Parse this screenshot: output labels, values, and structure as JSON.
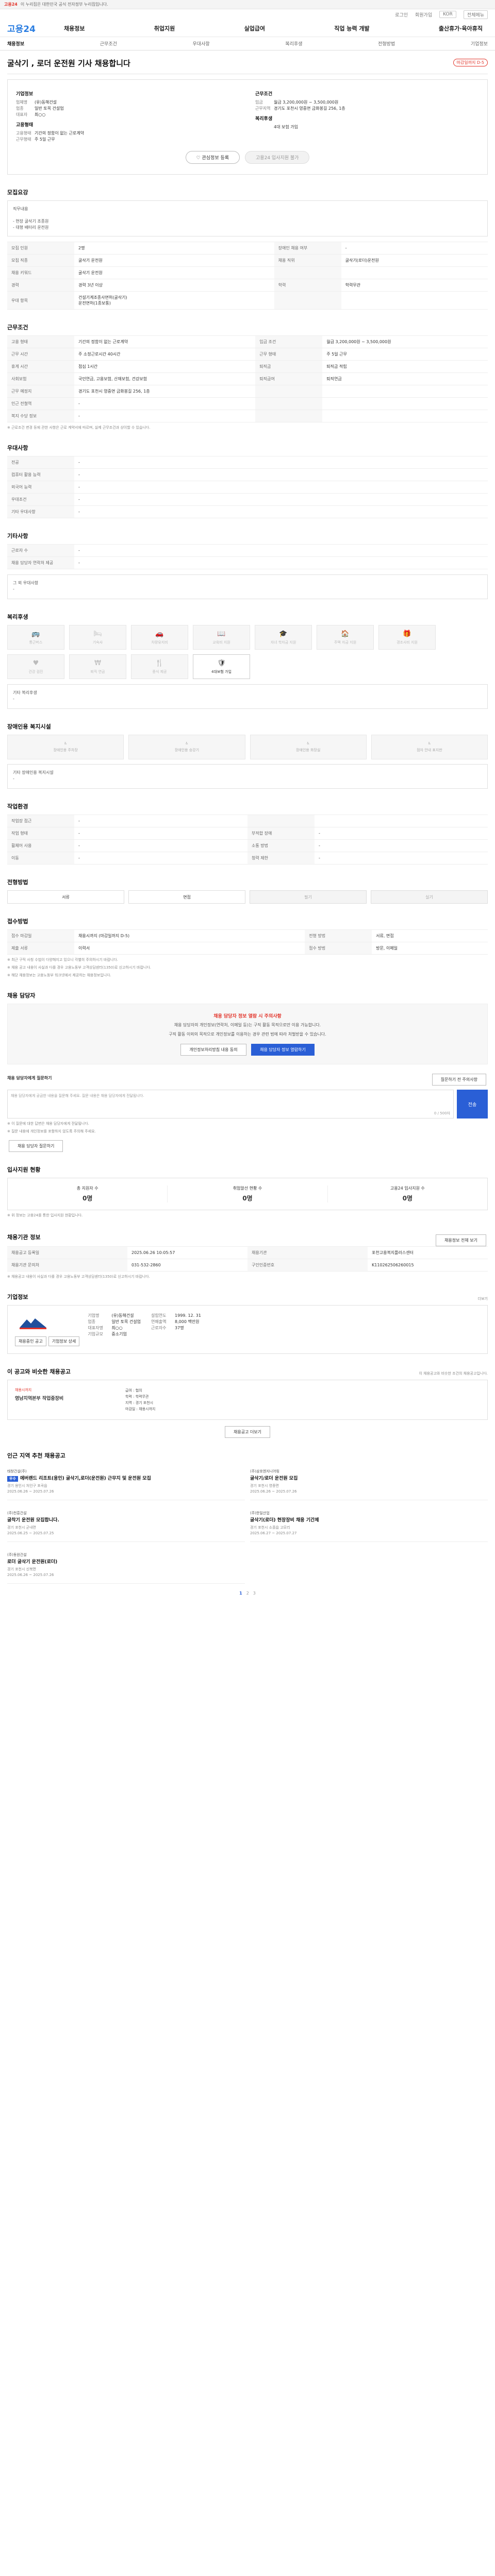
{
  "topbar": {
    "tag": "고용24",
    "text": "이 누리집은 대한민국 공식 전자정부 누리집입니다."
  },
  "util": {
    "login": "로그인",
    "join": "회원가입",
    "lang": "KOR",
    "menu": "전체메뉴"
  },
  "gnb": {
    "logo": "고용24",
    "menu": [
      "채용정보",
      "취업지원",
      "실업급여",
      "직업 능력 개발",
      "출산휴가·육아휴직"
    ]
  },
  "tabs": [
    "채용정보",
    "근무조건",
    "우대사항",
    "복리후생",
    "전형방법",
    "기업정보"
  ],
  "head": {
    "title": "굴삭기 , 로더 운전원 기사 채용합니다",
    "dday": "마감일까지 D-5"
  },
  "summary": {
    "company_label": "기업정보",
    "company": [
      [
        "업체명",
        "(유)동해건설"
      ],
      [
        "업종",
        "일반 토목 건설업"
      ],
      [
        "대표자",
        "최○○"
      ]
    ],
    "work_label": "근무조건",
    "work": [
      [
        "임금",
        "월급 3,200,000원 ~ 3,500,000원"
      ],
      [
        "근무지역",
        "경기도 포천시 영중면 금화봉길 256, 1층"
      ]
    ],
    "qual_label": "지원자격",
    "qual": [
      [
        "경력",
        "경력 3년 이상"
      ],
      [
        "학력",
        "학력무관"
      ]
    ],
    "type_label": "고용형태",
    "type": [
      [
        "고용형태",
        "기간의 정함이 없는 근로계약"
      ],
      [
        "근무형태",
        "주 5일 근무"
      ]
    ],
    "etc_label": "복리후생",
    "etc": [
      [
        "",
        "4대 보험 가입"
      ]
    ],
    "buttons": {
      "scrap": "관심정보 등록",
      "apply": "고용24 입사지원 불가"
    }
  },
  "job": {
    "title": "모집요강",
    "desc": "직무내용\n\n- 현장 굴삭기 조종원\n- 대형 배터리 운전원",
    "rows": [
      [
        "모집 인원",
        "2명",
        "장애인 채용 여부",
        "-"
      ],
      [
        "모집 직종",
        "굴삭기 운전원",
        "채용 직위",
        "굴삭기(로더)운전원"
      ],
      [
        "채용 키워드",
        "굴삭기 운전원",
        "",
        ""
      ],
      [
        "경력",
        "경력 3년 이상",
        "학력",
        "학력무관"
      ],
      [
        "우대 항목",
        "건설기계조종사면허(굴삭기)\n운전면허(1종보통)",
        "",
        ""
      ]
    ]
  },
  "cond": {
    "title": "근무조건",
    "rows": [
      [
        "고용 형태",
        "기간의 정함이 없는 근로계약",
        "임금 조건",
        "월급 3,200,000원 ~ 3,500,000원"
      ],
      [
        "근무 시간",
        "주 소정근로시간 40시간",
        "근무 형태",
        "주 5일 근무"
      ],
      [
        "휴게 시간",
        "점심 1시간",
        "퇴직금",
        "퇴직금 적립"
      ],
      [
        "사회보험",
        "국민연금, 고용보험, 산재보험, 건강보험",
        "퇴직급여",
        "퇴직연금"
      ],
      [
        "근무 예정지",
        "경기도 포천시 영중면 금화봉길 256, 1층",
        "",
        ""
      ],
      [
        "인근 전철역",
        "-",
        "",
        ""
      ],
      [
        "복지 수당 정보",
        "-",
        "",
        ""
      ]
    ],
    "note": "※ 근로조건 변경 등에 관한 사항은 근로 계약서에 따르며, 실제 근무조건과 상이할 수 있습니다."
  },
  "pref": {
    "title": "우대사항",
    "rows": [
      [
        "전공",
        "-"
      ],
      [
        "컴퓨터 활용 능력",
        "-"
      ],
      [
        "외국어 능력",
        "-"
      ],
      [
        "우대조건",
        "-"
      ],
      [
        "기타 우대사항",
        "-"
      ]
    ]
  },
  "etc": {
    "title": "기타사항",
    "rows": [
      [
        "근로자 수",
        "-"
      ],
      [
        "채용 담당자 연락처 제공",
        "-"
      ]
    ],
    "extra_label": "그 외 우대사항",
    "extra": "-"
  },
  "welfare": {
    "title": "복리후생",
    "tiles": [
      {
        "label": "통근버스",
        "on": false,
        "icon": "bus-icon"
      },
      {
        "label": "기숙사",
        "on": false,
        "icon": "bed-icon"
      },
      {
        "label": "차량유지비",
        "on": false,
        "icon": "car-icon"
      },
      {
        "label": "교육비 지원",
        "on": false,
        "icon": "book-icon"
      },
      {
        "label": "자녀 학자금 지원",
        "on": false,
        "icon": "cap-icon"
      },
      {
        "label": "주택 자금 지원",
        "on": false,
        "icon": "house-icon"
      },
      {
        "label": "경조사비 지원",
        "on": false,
        "icon": "gift-icon"
      },
      {
        "label": "건강 검진",
        "on": false,
        "icon": "health-icon"
      },
      {
        "label": "퇴직 연금",
        "on": false,
        "icon": "money-icon"
      },
      {
        "label": "중식 제공",
        "on": false,
        "icon": "meal-icon"
      },
      {
        "label": "4대보험 가입",
        "on": true,
        "icon": "shield-icon"
      }
    ],
    "extra_label": "기타 복리후생",
    "extra": "-"
  },
  "disab": {
    "title": "장애인용 복지시설",
    "tiles": [
      "장애인용 주차장",
      "장애인용 승강기",
      "장애인용 화장실",
      "점자 안내 표지판"
    ],
    "extra_label": "기타 장애인용 복지시설",
    "extra": "-"
  },
  "env": {
    "title": "작업환경",
    "rows": [
      [
        "작업장 접근",
        "-",
        "",
        ""
      ],
      [
        "작업 형태",
        "-",
        "부적합 장애",
        "-"
      ],
      [
        "휠체어 사용",
        "-",
        "소통 방법",
        "-"
      ],
      [
        "이동",
        "-",
        "청력 제한",
        "-"
      ]
    ]
  },
  "proc": {
    "title": "전형방법",
    "steps": [
      "서류",
      "면접",
      "필기",
      "실기"
    ]
  },
  "apply": {
    "title": "접수방법",
    "rows": [
      [
        "접수 마감일",
        "채용시까지 (마감일까지 D-5)",
        "전형 방법",
        "서류, 면접"
      ],
      [
        "제출 서류",
        "이력서",
        "접수 방법",
        "방문, 이메일"
      ]
    ],
    "notes": [
      "※ 최근 구직 사칭 수법이 다양해지고 있으니 각별히 주의하시기 바랍니다.",
      "※ 채용 공고 내용이 사실과 다를 경우 고용노동부 고객상담센터(1350)로 신고하시기 바랍니다.",
      "※ 해당 채용정보는 고용노동부 워크넷에서 제공하는 채용정보입니다."
    ]
  },
  "contact": {
    "title": "채용 담당자",
    "t1": "채용 담당자 정보 열람 시 주의사항",
    "p1": "채용 담당자의 개인정보(연락처, 이메일 등)는 구직 활동 목적으로만 이용 가능합니다.",
    "p2": "구직 활동 이외의 목적으로 개인정보를 이용하는 경우 관련 법에 따라 처벌받을 수 있습니다.",
    "btn1": "개인정보처리방침 내용 동의",
    "btn2": "채용 담당자 정보 열람하기",
    "q_label": "채용 담당자에게 질문하기",
    "q_sub": "질문하기 전 주의사항",
    "q_placeholder": "채용 담당자에게 궁금한 내용을 질문해 주세요. 질문 내용은 채용 담당자에게 전달됩니다.",
    "q_count": "0 / 500자",
    "q_send": "전송",
    "notes": [
      "※ 이 질문에 대한 답변은 채용 담당자에게 전달됩니다.",
      "※ 질문 내용에 개인정보를 포함하지 않도록 주의해 주세요."
    ],
    "q_btn": "채용 담당자 질문하기"
  },
  "stats": {
    "title": "입사지원 현황",
    "items": [
      [
        "총 지원자 수",
        "0명"
      ],
      [
        "취업알선 현황 수",
        "0명"
      ],
      [
        "고용24 입사지원 수",
        "0명"
      ]
    ],
    "note": "※ 위 정보는 고용24를 통한 입사지원 현황입니다."
  },
  "info": {
    "title": "채용기관 정보",
    "link": "채용정보 전체 보기",
    "rows": [
      [
        "채용공고 등록일",
        "2025.06.26 10:05:57",
        "채용기관",
        "포천고용복지플러스센터"
      ],
      [
        "채용기관 문의처",
        "031-532-2860",
        "구인인증번호",
        "K110262506260015"
      ]
    ],
    "notes": [
      "※ 채용공고 내용이 사실과 다를 경우 고용노동부 고객상담센터(1350)로 신고하시기 바랍니다."
    ]
  },
  "company": {
    "title": "기업정보",
    "more": "더보기",
    "name": "(유)동해건설",
    "cols": [
      [
        [
          "기업명",
          "(유)동해건설"
        ],
        [
          "업종",
          "일반 토목 건설업"
        ],
        [
          "대표자명",
          "최○○"
        ],
        [
          "기업규모",
          "중소기업"
        ]
      ],
      [
        [
          "설립연도",
          "1999. 12. 31"
        ],
        [
          "연매출액",
          "8,000 백만원"
        ],
        [
          "근로자수",
          "37명"
        ]
      ]
    ],
    "btn1": "채용중인 공고",
    "btn2": "기업정보 상세"
  },
  "rec": {
    "title": "이 공고와 비슷한 채용공고",
    "sub": "이 채용공고와 비슷한 조건의 채용공고입니다.",
    "more": "채용공고 더보기",
    "items": [
      {
        "tag": "채용시까지",
        "name": "영남지역본부 작업중장비",
        "lines": [
          "급여 : 협의",
          "학력 : 학력무관",
          "지역 : 경기 포천시",
          "마감일 : 채용시까지"
        ]
      }
    ]
  },
  "near": {
    "title": "인근 지역 추천 채용공고",
    "cards": [
      {
        "co": "태창건설(주)",
        "badge": "우수",
        "title": "에버랜드 리조트(용인) 굴삭기,로더(운전원) 근무지 및 운전원 모집",
        "loc": "경기 용인시 처인구 포곡읍",
        "date": "2025.06.26 ~ 2025.07.26"
      },
      {
        "co": "(주)삼호엔지니어링",
        "badge": "",
        "title": "굴삭기/로더 운전원 모집",
        "loc": "경기 포천시 영중면",
        "date": "2025.06.26 ~ 2025.07.26"
      },
      {
        "co": "(주)천흥건설",
        "badge": "",
        "title": "굴착기 운전원 모집합니다.",
        "loc": "경기 포천시 군내면",
        "date": "2025.06.25 ~ 2025.07.25"
      },
      {
        "co": "(주)한일산업",
        "badge": "",
        "title": "굴삭기(로더) 현장장비 채용 기간제",
        "loc": "경기 포천시 소흘읍 고모리",
        "date": "2025.06.27 ~ 2025.07.27"
      },
      {
        "co": "(주)동원건설",
        "badge": "",
        "title": "로더 굴삭기 운전원(로더)",
        "loc": "경기 포천시 신북면",
        "date": "2025.06.26 ~ 2025.07.26"
      }
    ],
    "pager": [
      "1",
      "2",
      "3"
    ]
  }
}
